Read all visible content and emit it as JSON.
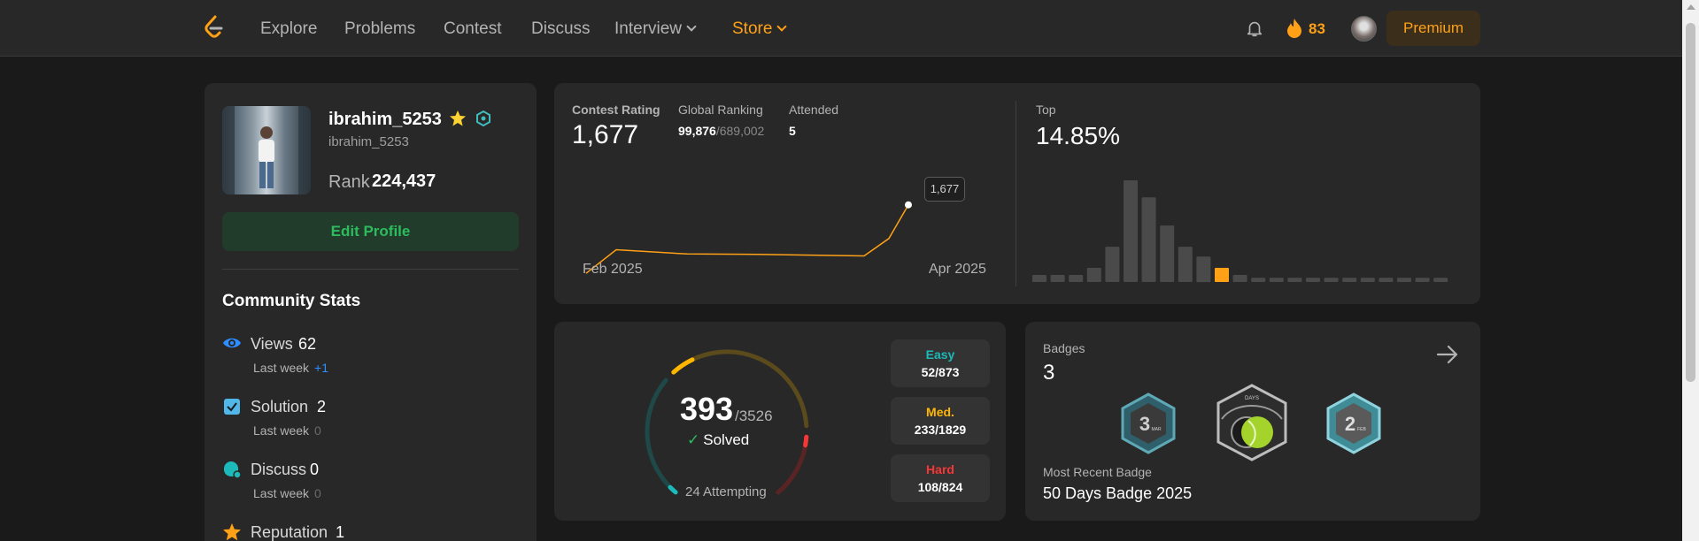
{
  "nav": {
    "links": [
      "Explore",
      "Problems",
      "Contest",
      "Discuss",
      "Interview",
      "Store"
    ],
    "streak": "83",
    "premium": "Premium"
  },
  "profile": {
    "username": "ibrahim_5253",
    "handle": "ibrahim_5253",
    "rank_label": "Rank",
    "rank": "224,437",
    "edit_label": "Edit Profile"
  },
  "community": {
    "title": "Community Stats",
    "stats": [
      {
        "label": "Views",
        "value": "62",
        "sub": "Last week",
        "delta": "+1"
      },
      {
        "label": "Solution",
        "value": "2",
        "sub": "Last week",
        "delta": "0"
      },
      {
        "label": "Discuss",
        "value": "0",
        "sub": "Last week",
        "delta": "0"
      },
      {
        "label": "Reputation",
        "value": "1"
      }
    ]
  },
  "contest": {
    "rating_label": "Contest Rating",
    "rating": "1,677",
    "global_label": "Global Ranking",
    "global_rank": "99,876",
    "global_total": "/689,002",
    "attended_label": "Attended",
    "attended": "5",
    "top_label": "Top",
    "top": "14.85%",
    "x_start": "Feb 2025",
    "x_end": "Apr 2025",
    "tooltip": "1,677"
  },
  "chart_data": [
    {
      "type": "line",
      "title": "Contest Rating",
      "x_ticks": [
        "Feb 2025",
        "Apr 2025"
      ],
      "series": [
        {
          "values": [
            1500,
            1561,
            1550,
            1549,
            1547,
            1545,
            1590,
            1677
          ]
        }
      ],
      "color": "#ffa116"
    },
    {
      "type": "bar",
      "title": "Top",
      "values": [
        5,
        5,
        5,
        10,
        25,
        72,
        60,
        40,
        25,
        18,
        10,
        5,
        3,
        3,
        3,
        3,
        3,
        3,
        3,
        3,
        3,
        3,
        3
      ],
      "highlight_index": 10,
      "color": "#4a4a4a",
      "highlight_color": "#ffa116"
    },
    {
      "type": "pie",
      "title": "Solved",
      "total": "393",
      "of": "3526",
      "categories": [
        "Easy",
        "Med.",
        "Hard"
      ],
      "values": [
        52,
        233,
        108
      ],
      "totals": [
        873,
        1829,
        824
      ]
    }
  ],
  "progress": {
    "solved": "393",
    "total": "/3526",
    "solved_label": "Solved",
    "attempting": "24 Attempting",
    "easy_label": "Easy",
    "easy": "52/873",
    "med_label": "Med.",
    "med": "233/1829",
    "hard_label": "Hard",
    "hard": "108/824"
  },
  "badges": {
    "label": "Badges",
    "count": "3",
    "recent_label": "Most Recent Badge",
    "recent": "50 Days Badge 2025",
    "items": [
      {
        "icon": "march-badge",
        "num": "3",
        "tag": "MAR"
      },
      {
        "icon": "50-days-badge",
        "tag": "DAYS"
      },
      {
        "icon": "feb-badge",
        "num": "2",
        "tag": "FEB"
      }
    ]
  },
  "colors": {
    "accent": "#ffa116",
    "easy": "#1cbaba",
    "medium": "#ffb700",
    "hard": "#f63737",
    "green": "#2cbb5d"
  }
}
